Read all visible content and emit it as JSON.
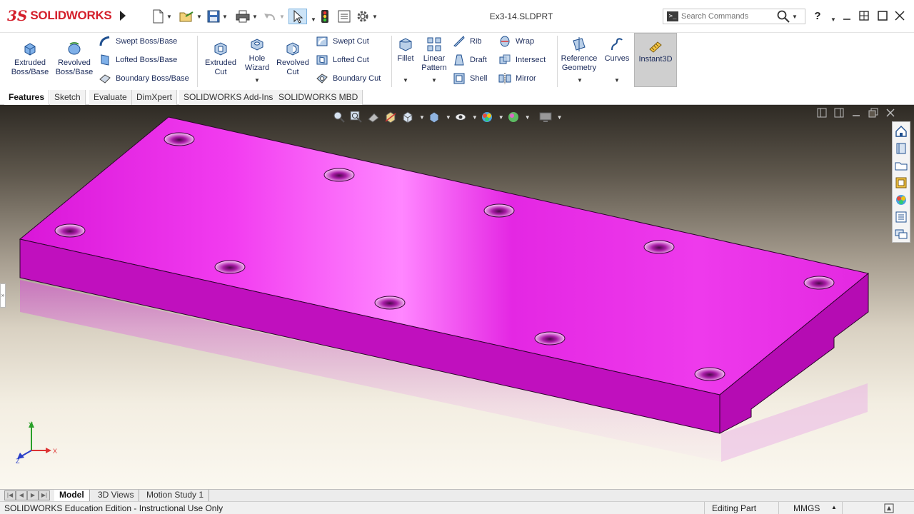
{
  "app": {
    "logo_ds": "3S",
    "logo_text": "SOLIDWORKS",
    "document_title": "Ex3-14.SLDPRT",
    "search_placeholder": "Search Commands",
    "help_label": "?"
  },
  "ribbon": {
    "extruded_boss": "Extruded\nBoss/Base",
    "revolved_boss": "Revolved\nBoss/Base",
    "swept_boss": "Swept Boss/Base",
    "lofted_boss": "Lofted Boss/Base",
    "boundary_boss": "Boundary Boss/Base",
    "extruded_cut": "Extruded\nCut",
    "hole_wizard": "Hole\nWizard",
    "revolved_cut": "Revolved\nCut",
    "swept_cut": "Swept Cut",
    "lofted_cut": "Lofted Cut",
    "boundary_cut": "Boundary Cut",
    "fillet": "Fillet",
    "linear_pattern": "Linear\nPattern",
    "rib": "Rib",
    "draft": "Draft",
    "shell": "Shell",
    "wrap": "Wrap",
    "intersect": "Intersect",
    "mirror": "Mirror",
    "reference_geometry": "Reference\nGeometry",
    "curves": "Curves",
    "instant3d": "Instant3D"
  },
  "tabs": [
    {
      "label": "Features",
      "active": true
    },
    {
      "label": "Sketch",
      "active": false
    },
    {
      "label": "Evaluate",
      "active": false
    },
    {
      "label": "DimXpert",
      "active": false
    },
    {
      "label": "SOLIDWORKS Add-Ins",
      "active": false
    },
    {
      "label": "SOLIDWORKS MBD",
      "active": false
    }
  ],
  "bottom_tabs": [
    {
      "label": "Model",
      "active": true
    },
    {
      "label": "3D Views",
      "active": false
    },
    {
      "label": "Motion Study 1",
      "active": false
    }
  ],
  "triad": {
    "x": "X",
    "y": "Y",
    "z": "Z"
  },
  "status": {
    "left": "SOLIDWORKS Education Edition - Instructional Use Only",
    "mode": "Editing Part",
    "units": "MMGS"
  },
  "colors": {
    "part": "#e21ee0",
    "accent": "#d4202c",
    "ribbon_text": "#1a2a5a"
  }
}
